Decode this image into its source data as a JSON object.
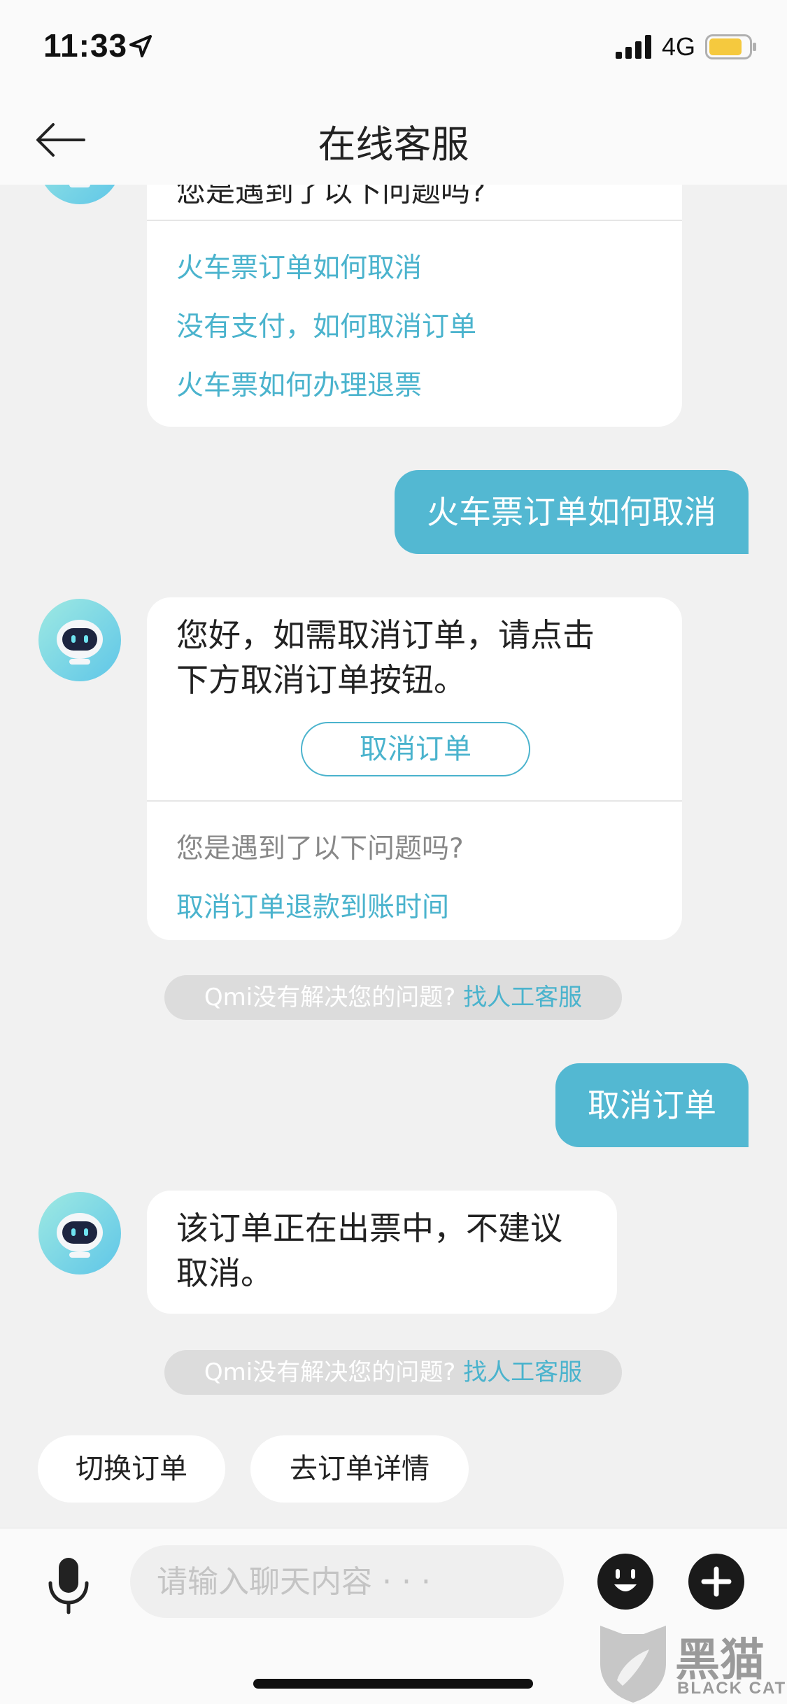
{
  "status_bar": {
    "time": "11:33",
    "network": "4G"
  },
  "header": {
    "title": "在线客服"
  },
  "messages": {
    "card1": {
      "prompt": "您是遇到了以下问题吗?",
      "links": [
        "火车票订单如何取消",
        "没有支付，如何取消订单",
        "火车票如何办理退票"
      ]
    },
    "user1": "火车票订单如何取消",
    "card2": {
      "line1": "您好，如需取消订单，请点击",
      "line2": "下方取消订单按钮。",
      "button": "取消订单",
      "prompt": "您是遇到了以下问题吗?",
      "link": "取消订单退款到账时间"
    },
    "hint1": {
      "text": "Qmi没有解决您的问题? ",
      "link": "找人工客服"
    },
    "user2": "取消订单",
    "card3": {
      "line1": "该订单正在出票中，不建议",
      "line2": "取消。"
    },
    "hint2": {
      "text": "Qmi没有解决您的问题? ",
      "link": "找人工客服"
    }
  },
  "quick_actions": [
    "切换订单",
    "去订单详情"
  ],
  "input": {
    "placeholder": "请输入聊天内容 · · ·"
  },
  "watermark": {
    "cn": "黑猫",
    "en": "BLACK CAT"
  },
  "colors": {
    "accent": "#53b8d2",
    "link": "#4ab3cd",
    "background": "#f1f1f1"
  }
}
